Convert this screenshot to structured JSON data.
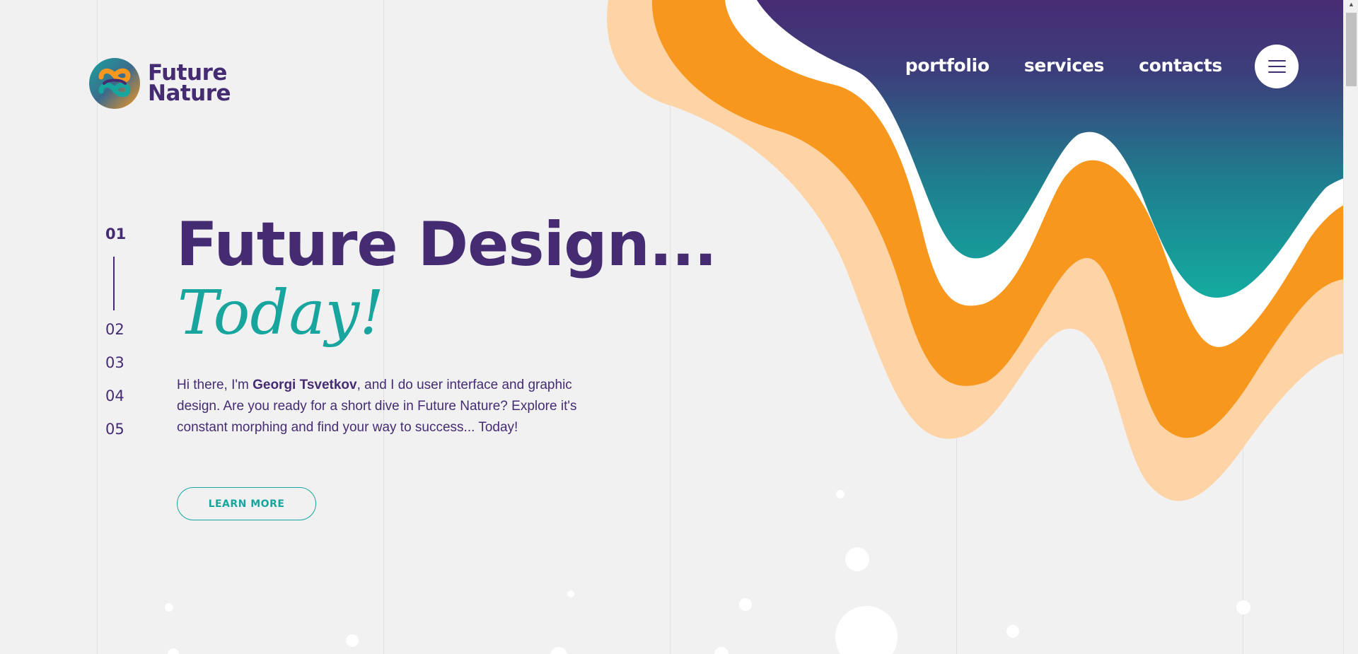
{
  "brand": {
    "logo_line1": "Future",
    "logo_line2": "Nature"
  },
  "nav": {
    "items": [
      {
        "label": "portfolio"
      },
      {
        "label": "services"
      },
      {
        "label": "contacts"
      }
    ],
    "menu_icon": "hamburger-icon"
  },
  "slides": {
    "items": [
      {
        "label": "01",
        "active": true
      },
      {
        "label": "02",
        "active": false
      },
      {
        "label": "03",
        "active": false
      },
      {
        "label": "04",
        "active": false
      },
      {
        "label": "05",
        "active": false
      }
    ]
  },
  "hero": {
    "headline": "Future Design...",
    "subheadline": "Today!",
    "intro_before": "Hi there, I'm ",
    "intro_name": "Georgi Tsvetkov",
    "intro_after": ", and I do user interface and graphic design. Are you ready for a short dive in Future Nature? Explore it's constant morphing and find your way to success... Today!",
    "cta_label": "LEARN MORE"
  },
  "colors": {
    "background": "#f1f1f1",
    "primary_purple": "#452c72",
    "teal": "#17a59e",
    "orange": "#f7971e",
    "peach": "#fed4a6",
    "white": "#ffffff"
  }
}
